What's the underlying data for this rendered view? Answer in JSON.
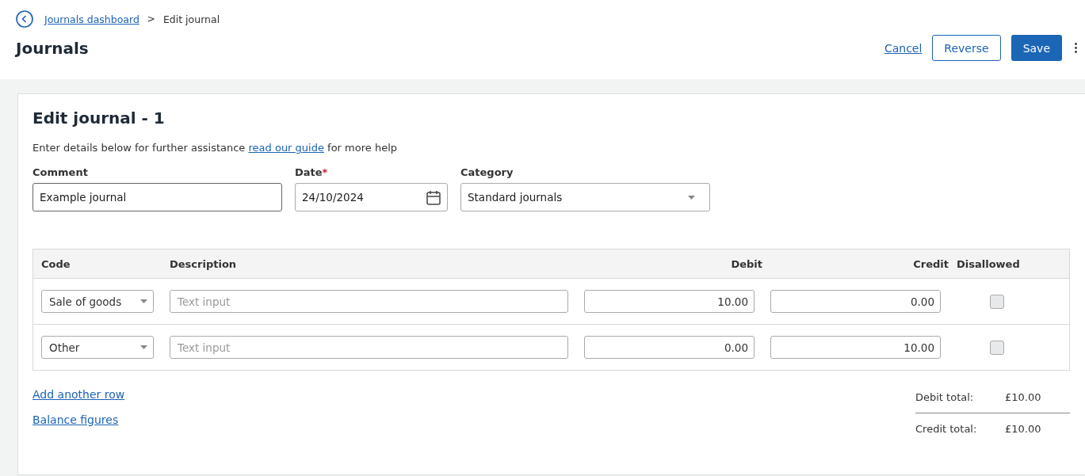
{
  "breadcrumb": {
    "link": "Journals dashboard",
    "separator": ">",
    "current": "Edit journal"
  },
  "page_title": "Journals",
  "actions": {
    "cancel": "Cancel",
    "reverse": "Reverse",
    "save": "Save"
  },
  "card": {
    "title": "Edit journal - 1",
    "intro": {
      "before": "Enter details below for further assistance",
      "link": "read our guide",
      "after": "for more help"
    },
    "fields": [
      {
        "kind": "text",
        "label": "Comment",
        "required": false,
        "value": "Example journal"
      },
      {
        "kind": "date",
        "label": "Date",
        "required": true,
        "value": "24/10/2024"
      },
      {
        "kind": "select",
        "label": "Category",
        "required": false,
        "value": "Standard journals"
      }
    ],
    "required_mark": "*",
    "table": {
      "columns": [
        "Code",
        "Description",
        "Debit",
        "Credit",
        "Disallowed"
      ],
      "rows": [
        {
          "code": "Sale of goods",
          "description_placeholder": "Text input",
          "debit": "10.00",
          "credit": "0.00",
          "disallowed": false
        },
        {
          "code": "Other",
          "description_placeholder": "Text input",
          "debit": "0.00",
          "credit": "10.00",
          "disallowed": false
        }
      ]
    },
    "links": [
      "Add another row",
      "Balance figures"
    ],
    "totals": [
      {
        "label": "Debit total:",
        "value": "£10.00"
      },
      {
        "label": "Credit total:",
        "value": "£10.00"
      }
    ]
  }
}
